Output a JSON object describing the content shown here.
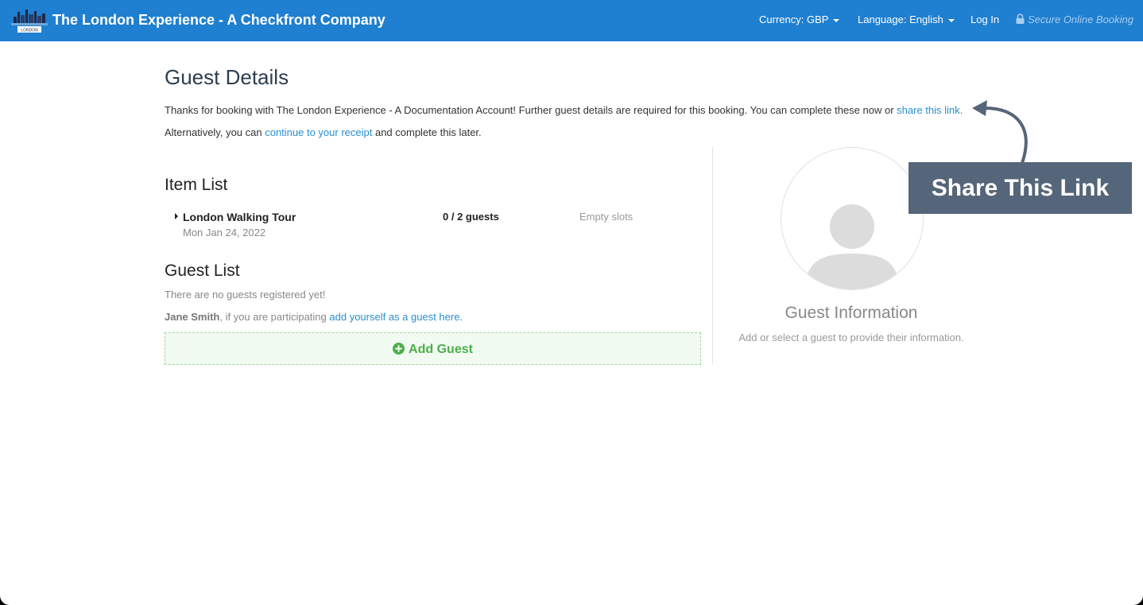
{
  "navbar": {
    "brand": "The London Experience - A Checkfront Company",
    "currency": "Currency: GBP",
    "language": "Language: English",
    "login": "Log In",
    "secure": "Secure Online Booking",
    "logo_text": "LONDON"
  },
  "header": {
    "title": "Guest Details"
  },
  "intro": {
    "line1": "Thanks for booking with The London Experience - A Documentation Account! Further guest details are required for this booking. You can complete these now or ",
    "share_link": "share this link.",
    "line2_prefix": "Alternatively, you can ",
    "receipt_link": "continue to your receipt",
    "line2_suffix": " and complete this later."
  },
  "item_list": {
    "heading": "Item List",
    "items": [
      {
        "name": "London Walking Tour",
        "date": "Mon Jan 24, 2022",
        "count": "0",
        "total": "/ 2 guests",
        "status": "Empty slots"
      }
    ]
  },
  "guest_list": {
    "heading": "Guest List",
    "empty_text": "There are no guests registered yet!",
    "participant_name": "Jane Smith",
    "participant_text": ", if you are participating ",
    "participant_link": "add yourself as a guest here.",
    "add_button": "Add Guest"
  },
  "guest_info": {
    "title": "Guest Information",
    "subtitle": "Add or select a guest to provide their information."
  },
  "callout": {
    "label": "Share This Link"
  },
  "colors": {
    "navbar": "#1f7fd0",
    "link": "#2a8fd0",
    "add_guest": "#4cae4c",
    "callout": "#55657a"
  }
}
